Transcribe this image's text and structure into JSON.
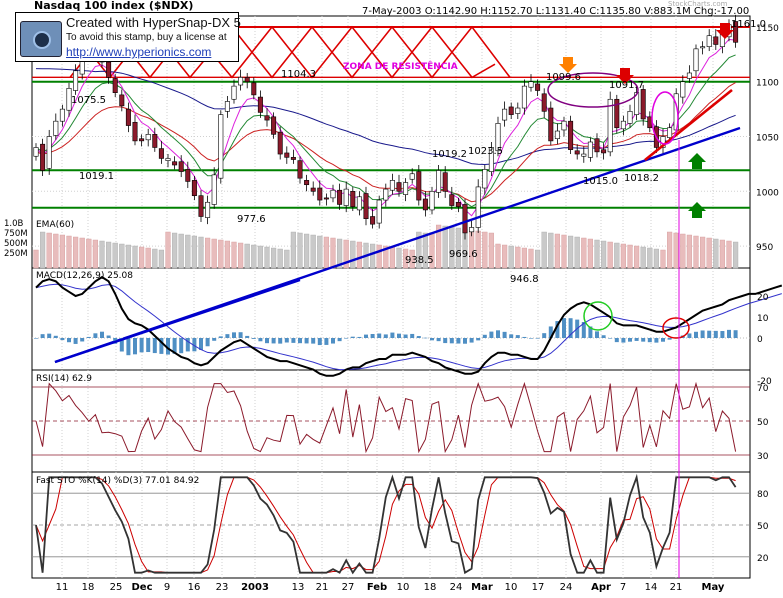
{
  "header": {
    "title": "Nasdaq 100 index ($NDX)",
    "quote": "7-May-2003 O:1142.90 H:1152.70 L:1131.40 C:1135.80 V:883.1M Chg:-17.00",
    "watermark": "StockCharts.com"
  },
  "stamp": {
    "line1": "Created with HyperSnap-DX 5",
    "line2": "To avoid this stamp, buy a license at",
    "line3": "http://www.hyperionics.com"
  },
  "colors": {
    "up_candle": "#ffffff",
    "down_candle": "#8b1a2b",
    "support_lines": "#008000",
    "resistance_zone": "#dd0000",
    "trendline": "#0000cc",
    "ema": "#1a1a8c",
    "macd_hist": "#4f8fc4"
  },
  "chart_data": [
    {
      "type": "line",
      "name": "price",
      "candles_close": [
        1040,
        1019,
        1050,
        1064,
        1075,
        1094,
        1110,
        1122,
        1126,
        1130,
        1118,
        1104,
        1090,
        1078,
        1060,
        1046,
        1046,
        1052,
        1040,
        1030,
        1030,
        1024,
        1018,
        1009,
        996,
        977,
        990,
        1015,
        1070,
        1082,
        1096,
        1104,
        1100,
        1088,
        1072,
        1065,
        1052,
        1034,
        1031,
        1029,
        1012,
        1006,
        1000,
        992,
        993,
        1001,
        988,
        1002,
        986,
        995,
        975,
        970,
        992,
        1002,
        1010,
        1000,
        1008,
        1016,
        992,
        983,
        1000,
        1019,
        1000,
        987,
        986,
        962,
        967,
        1004,
        1020,
        1040,
        1062,
        1075,
        1070,
        1076,
        1096,
        1100,
        1092,
        1073,
        1046,
        1055,
        1064,
        1038,
        1034,
        1034,
        1045,
        1036,
        1035,
        1084,
        1058,
        1064,
        1073,
        1090,
        1066,
        1058,
        1040,
        1050,
        1058,
        1089,
        1100,
        1108,
        1130,
        1132,
        1142,
        1134,
        1144,
        1152,
        1136
      ],
      "ylim": [
        930,
        1160
      ],
      "y_ticks": [
        950,
        1000,
        1050,
        1100,
        1150
      ],
      "annotations": [
        "1075.5",
        "1019.1",
        "1104.3",
        "977.6",
        "1019.2",
        "1023.5",
        "969.6",
        "938.5",
        "946.8",
        "1099.6",
        "1091.7",
        "1015.0",
        "1018.2",
        "1161.0",
        "ZONA DE RESISTÊNCIA"
      ],
      "support_levels": [
        1100,
        1019.2,
        985
      ],
      "resistance_level": 1150,
      "ema_label": "EMA(60)"
    },
    {
      "type": "bar",
      "name": "volume",
      "y_ticks": [
        "1.0B",
        "750M",
        "500M",
        "250M"
      ]
    },
    {
      "type": "line",
      "name": "macd",
      "label": "MACD(12,26,9) 25.08",
      "ylim": [
        -20,
        30
      ],
      "y_ticks": [
        20,
        10,
        0,
        -20
      ],
      "macd": [
        24,
        27,
        28,
        27,
        24,
        22,
        20,
        21,
        24,
        27,
        29,
        27,
        21,
        14,
        9,
        7,
        6,
        4,
        1,
        -2,
        -5,
        -7,
        -9,
        -10,
        -12,
        -13,
        -12,
        -9,
        -6,
        -4,
        -2,
        -1,
        -3,
        -5,
        -7,
        -9,
        -10,
        -11,
        -11,
        -12,
        -13,
        -14,
        -15,
        -17,
        -18,
        -18,
        -17,
        -15,
        -14,
        -14,
        -12,
        -11,
        -10,
        -10,
        -8,
        -8,
        -8,
        -7,
        -8,
        -9,
        -11,
        -12,
        -14,
        -15,
        -16,
        -17,
        -17,
        -16,
        -12,
        -9,
        -7,
        -7,
        -8,
        -8,
        -9,
        -10,
        -10,
        -6,
        0,
        6,
        11,
        14,
        16,
        17,
        16,
        14,
        12,
        10,
        7,
        6,
        6,
        6,
        5,
        4,
        3,
        3,
        4,
        5,
        7,
        9,
        11,
        13,
        14,
        15,
        16,
        18,
        19,
        20,
        21,
        21,
        22,
        23,
        24,
        25
      ]
    },
    {
      "type": "line",
      "name": "rsi",
      "label": "RSI(14) 62.9",
      "ylim": [
        20,
        80
      ],
      "y_ticks": [
        70,
        50,
        30
      ]
    },
    {
      "type": "line",
      "name": "stochastic",
      "label": "Fast STO %K(14) %D(3) 77.01 84.92",
      "ylim": [
        0,
        100
      ],
      "y_ticks": [
        80,
        50,
        20
      ]
    }
  ],
  "x_axis": {
    "labels": [
      "11",
      "18",
      "25",
      "Dec",
      "9",
      "16",
      "23",
      "2003",
      "13",
      "21",
      "27",
      "Feb",
      "10",
      "18",
      "24",
      "Mar",
      "10",
      "17",
      "24",
      "Apr",
      "7",
      "14",
      "21",
      "May"
    ]
  }
}
